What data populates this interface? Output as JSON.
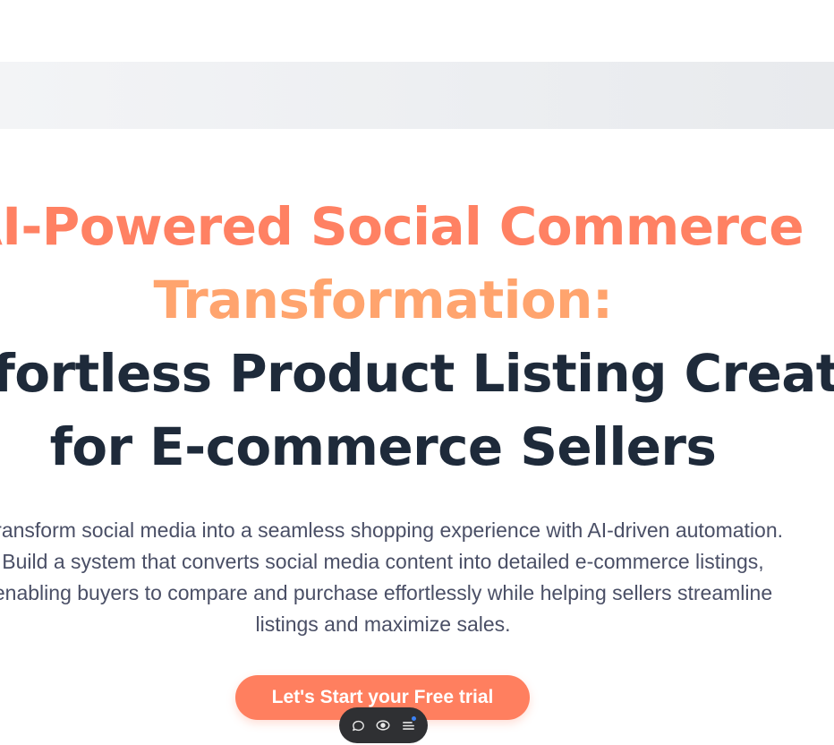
{
  "hero": {
    "title_line1": "AI-Powered Social Commerce",
    "title_line2": "Transformation:",
    "title_line3": "Effortless Product Listing Creation",
    "title_line4": "for E-commerce Sellers",
    "description_lines": [
      "Transform social media into a seamless shopping experience with AI-driven automation.",
      "Build a system that converts social media content into detailed e-commerce listings,",
      "enabling buyers to compare and purchase effortlessly while helping sellers streamline",
      "listings and maximize sales."
    ],
    "cta_label": "Let's Start your Free trial"
  },
  "toolbar": {
    "icons": [
      "comment-icon",
      "eye-icon",
      "menu-icon"
    ]
  },
  "colors": {
    "accent_primary": "#ff8163",
    "accent_secondary": "#ffa46e",
    "heading_dark": "#1e2a3a",
    "body_text": "#4a4f66",
    "cta_background": "#ff7f5f",
    "toolbar_background": "#2f3033"
  }
}
